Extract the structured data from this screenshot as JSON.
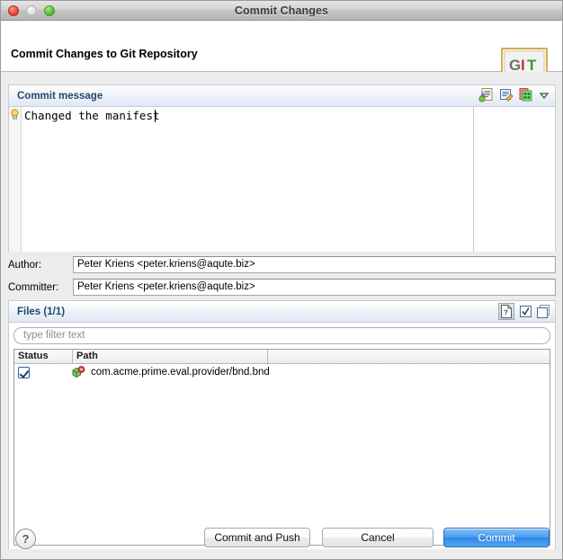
{
  "window": {
    "title": "Commit Changes",
    "traffic_lights": [
      "close-button",
      "minimize-button",
      "zoom-button"
    ]
  },
  "header": {
    "title": "Commit Changes to Git Repository",
    "logo": {
      "name": "git-logo",
      "letters": [
        "G",
        "I",
        "T"
      ],
      "colors": {
        "g": "#6e6e6e",
        "i": "#c0392b",
        "t": "#3f9242"
      }
    }
  },
  "commit_message_section": {
    "title": "Commit message",
    "tools": [
      {
        "name": "add-signed-off-by-icon",
        "tooltip": "Add Signed-off-by"
      },
      {
        "name": "add-change-id-icon",
        "tooltip": "Add Change-Id"
      },
      {
        "name": "amend-previous-commit-icon",
        "tooltip": "Amend Previous Commit"
      },
      {
        "name": "chevron-down-icon",
        "tooltip": "Menu"
      }
    ],
    "editor": {
      "text": "Changed the manifest",
      "marker": "quickfix-bulb-icon",
      "margin_guide": true
    }
  },
  "fields": [
    {
      "name": "author",
      "label": "Author:",
      "value": "Peter Kriens <peter.kriens@aqute.biz>",
      "placeholder": ""
    },
    {
      "name": "committer",
      "label": "Committer:",
      "value": "Peter Kriens <peter.kriens@aqute.biz>",
      "placeholder": ""
    }
  ],
  "files_section": {
    "title": "Files (1/1)",
    "count_selected": 1,
    "count_total": 1,
    "tools": [
      {
        "name": "show-untracked-files-icon",
        "pressed": true,
        "glyph": "?"
      },
      {
        "name": "select-all-icon",
        "pressed": false
      },
      {
        "name": "deselect-all-icon",
        "pressed": false
      }
    ],
    "filter": {
      "name": "filter-input",
      "value": "",
      "placeholder": "type filter text"
    },
    "table": {
      "columns": [
        "Status",
        "Path",
        ""
      ],
      "rows": [
        {
          "checked": true,
          "status_icon": "modified-package-icon",
          "path": "com.acme.prime.eval.provider/bnd.bnd"
        }
      ]
    }
  },
  "buttons": {
    "help": "?",
    "commit_and_push": "Commit and Push",
    "cancel": "Cancel",
    "commit": "Commit",
    "default_button": "commit"
  },
  "colors": {
    "accent": "#4c9ef0",
    "section_title": "#23486b",
    "window_bg": "#ececec"
  }
}
